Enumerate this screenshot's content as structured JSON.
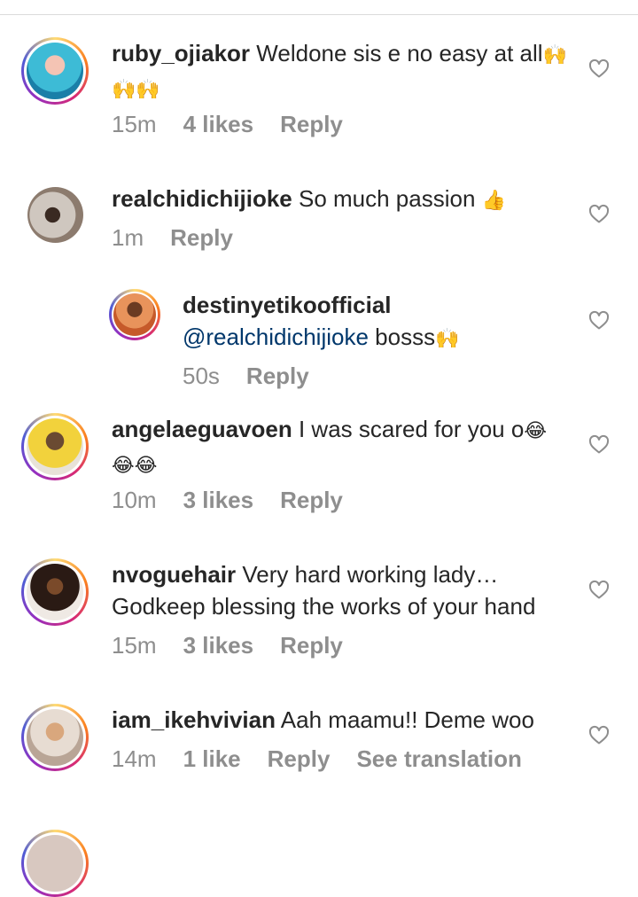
{
  "comments": [
    {
      "username": "ruby_ojiakor",
      "text_before": "Weldone sis e no easy at all",
      "mention": "",
      "text_after": "",
      "emoji": "🙌🙌🙌",
      "time": "15m",
      "likes": "4 likes",
      "reply": "Reply",
      "translation": ""
    },
    {
      "username": "realchidichijioke",
      "text_before": "So much passion",
      "mention": "",
      "text_after": "",
      "emoji": "👍",
      "time": "1m",
      "likes": "",
      "reply": "Reply",
      "translation": ""
    },
    {
      "username": "destinyetikoofficial",
      "text_before": "",
      "mention": "@realchidichijioke",
      "text_after": "bosss",
      "emoji": "🙌",
      "time": "50s",
      "likes": "",
      "reply": "Reply",
      "translation": ""
    },
    {
      "username": "angelaeguavoen",
      "text_before": "I was scared for you o",
      "mention": "",
      "text_after": "",
      "emoji": "😂😂😂",
      "time": "10m",
      "likes": "3 likes",
      "reply": "Reply",
      "translation": ""
    },
    {
      "username": "nvoguehair",
      "text_before": "Very hard working lady… Godkeep blessing the works of your hand",
      "mention": "",
      "text_after": "",
      "emoji": "",
      "time": "15m",
      "likes": "3 likes",
      "reply": "Reply",
      "translation": ""
    },
    {
      "username": "iam_ikehvivian",
      "text_before": "Aah maamu!! Deme woo",
      "mention": "",
      "text_after": "",
      "emoji": "",
      "time": "14m",
      "likes": "1 like",
      "reply": "Reply",
      "translation": "See translation"
    }
  ],
  "icons": {
    "like": "heart-outline-icon"
  },
  "colors": {
    "text": "#262626",
    "meta": "#8e8e8e",
    "mention": "#00376b",
    "divider": "#dbdbdb"
  }
}
